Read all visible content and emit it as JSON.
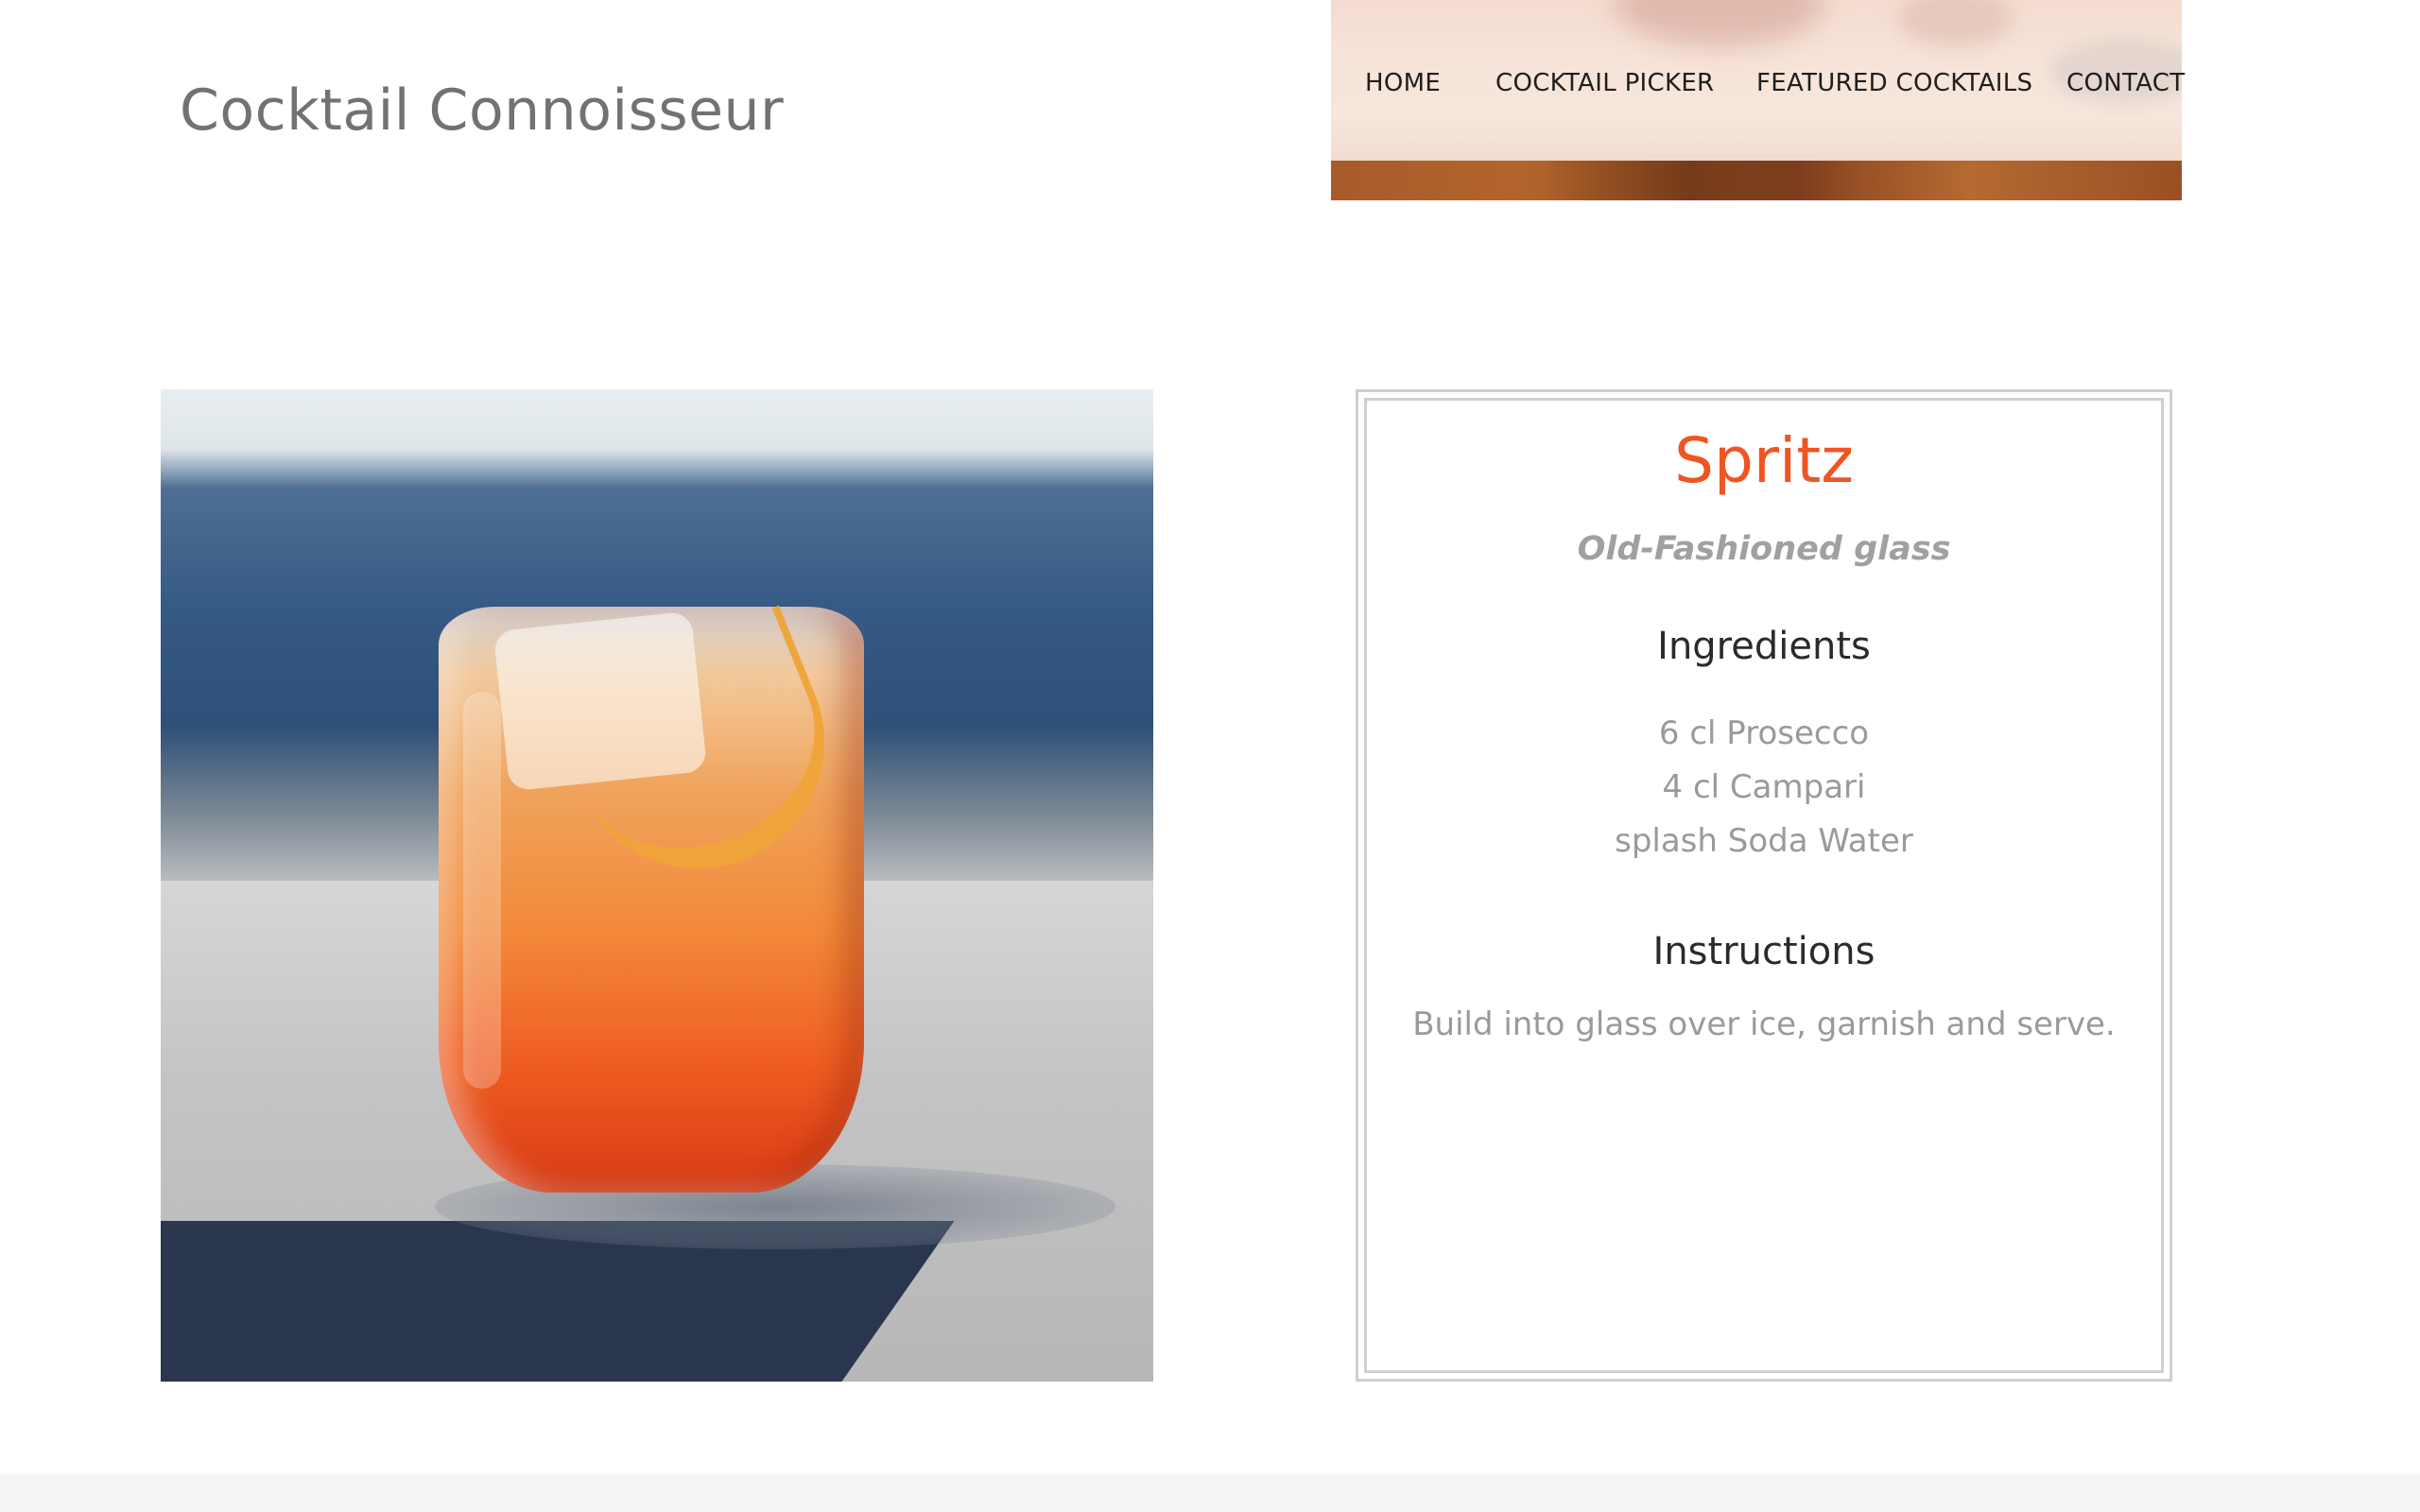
{
  "site": {
    "title": "Cocktail Connoisseur"
  },
  "nav": {
    "items": [
      {
        "label": "HOME"
      },
      {
        "label": "COCKTAIL PICKER"
      },
      {
        "label": "FEATURED COCKTAILS"
      },
      {
        "label": "CONTACT"
      }
    ]
  },
  "recipe": {
    "name": "Spritz",
    "glass": "Old-Fashioned glass",
    "ingredients_heading": "Ingredients",
    "ingredients": [
      "6 cl Prosecco",
      "4 cl Campari",
      "splash Soda Water"
    ],
    "instructions_heading": "Instructions",
    "instructions": "Build into glass over ice, garnish and serve."
  },
  "colors": {
    "accent": "#f05423",
    "title_gray": "#727272",
    "text_gray": "#9a9a9a",
    "heading_dark": "#2a2a2a",
    "border": "#cfcfcf"
  }
}
